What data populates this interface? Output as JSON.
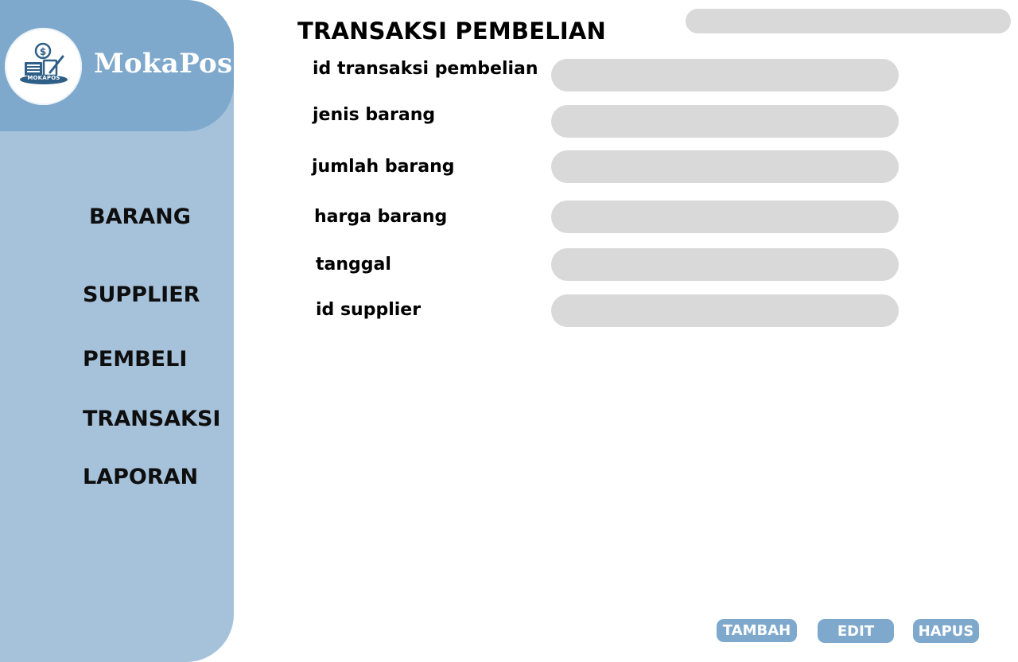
{
  "brand": {
    "name": "MokaPos",
    "logo_caption": "MOKAPOS",
    "logo_icon": "cash-register-dollar-icon"
  },
  "sidebar": {
    "items": [
      {
        "label": "BARANG"
      },
      {
        "label": "SUPPLIER"
      },
      {
        "label": "PEMBELI"
      },
      {
        "label": "TRANSAKSI"
      },
      {
        "label": "LAPORAN"
      }
    ]
  },
  "main": {
    "title": "TRANSAKSI PEMBELIAN",
    "search": {
      "value": "",
      "placeholder": ""
    },
    "fields": [
      {
        "label": "id transaksi pembelian",
        "value": ""
      },
      {
        "label": "jenis barang",
        "value": ""
      },
      {
        "label": "jumlah barang",
        "value": ""
      },
      {
        "label": "harga barang",
        "value": ""
      },
      {
        "label": "tanggal",
        "value": ""
      },
      {
        "label": "id supplier",
        "value": ""
      }
    ]
  },
  "actions": {
    "add_label": "TAMBAH",
    "edit_label": "EDIT",
    "delete_label": "HAPUS"
  },
  "colors": {
    "sidebar": "#a6c2db",
    "brand_header": "#7ea9cc",
    "input_fill": "#d9d9d9",
    "button": "#7ea9cc",
    "logo_blue": "#2e5f86"
  }
}
